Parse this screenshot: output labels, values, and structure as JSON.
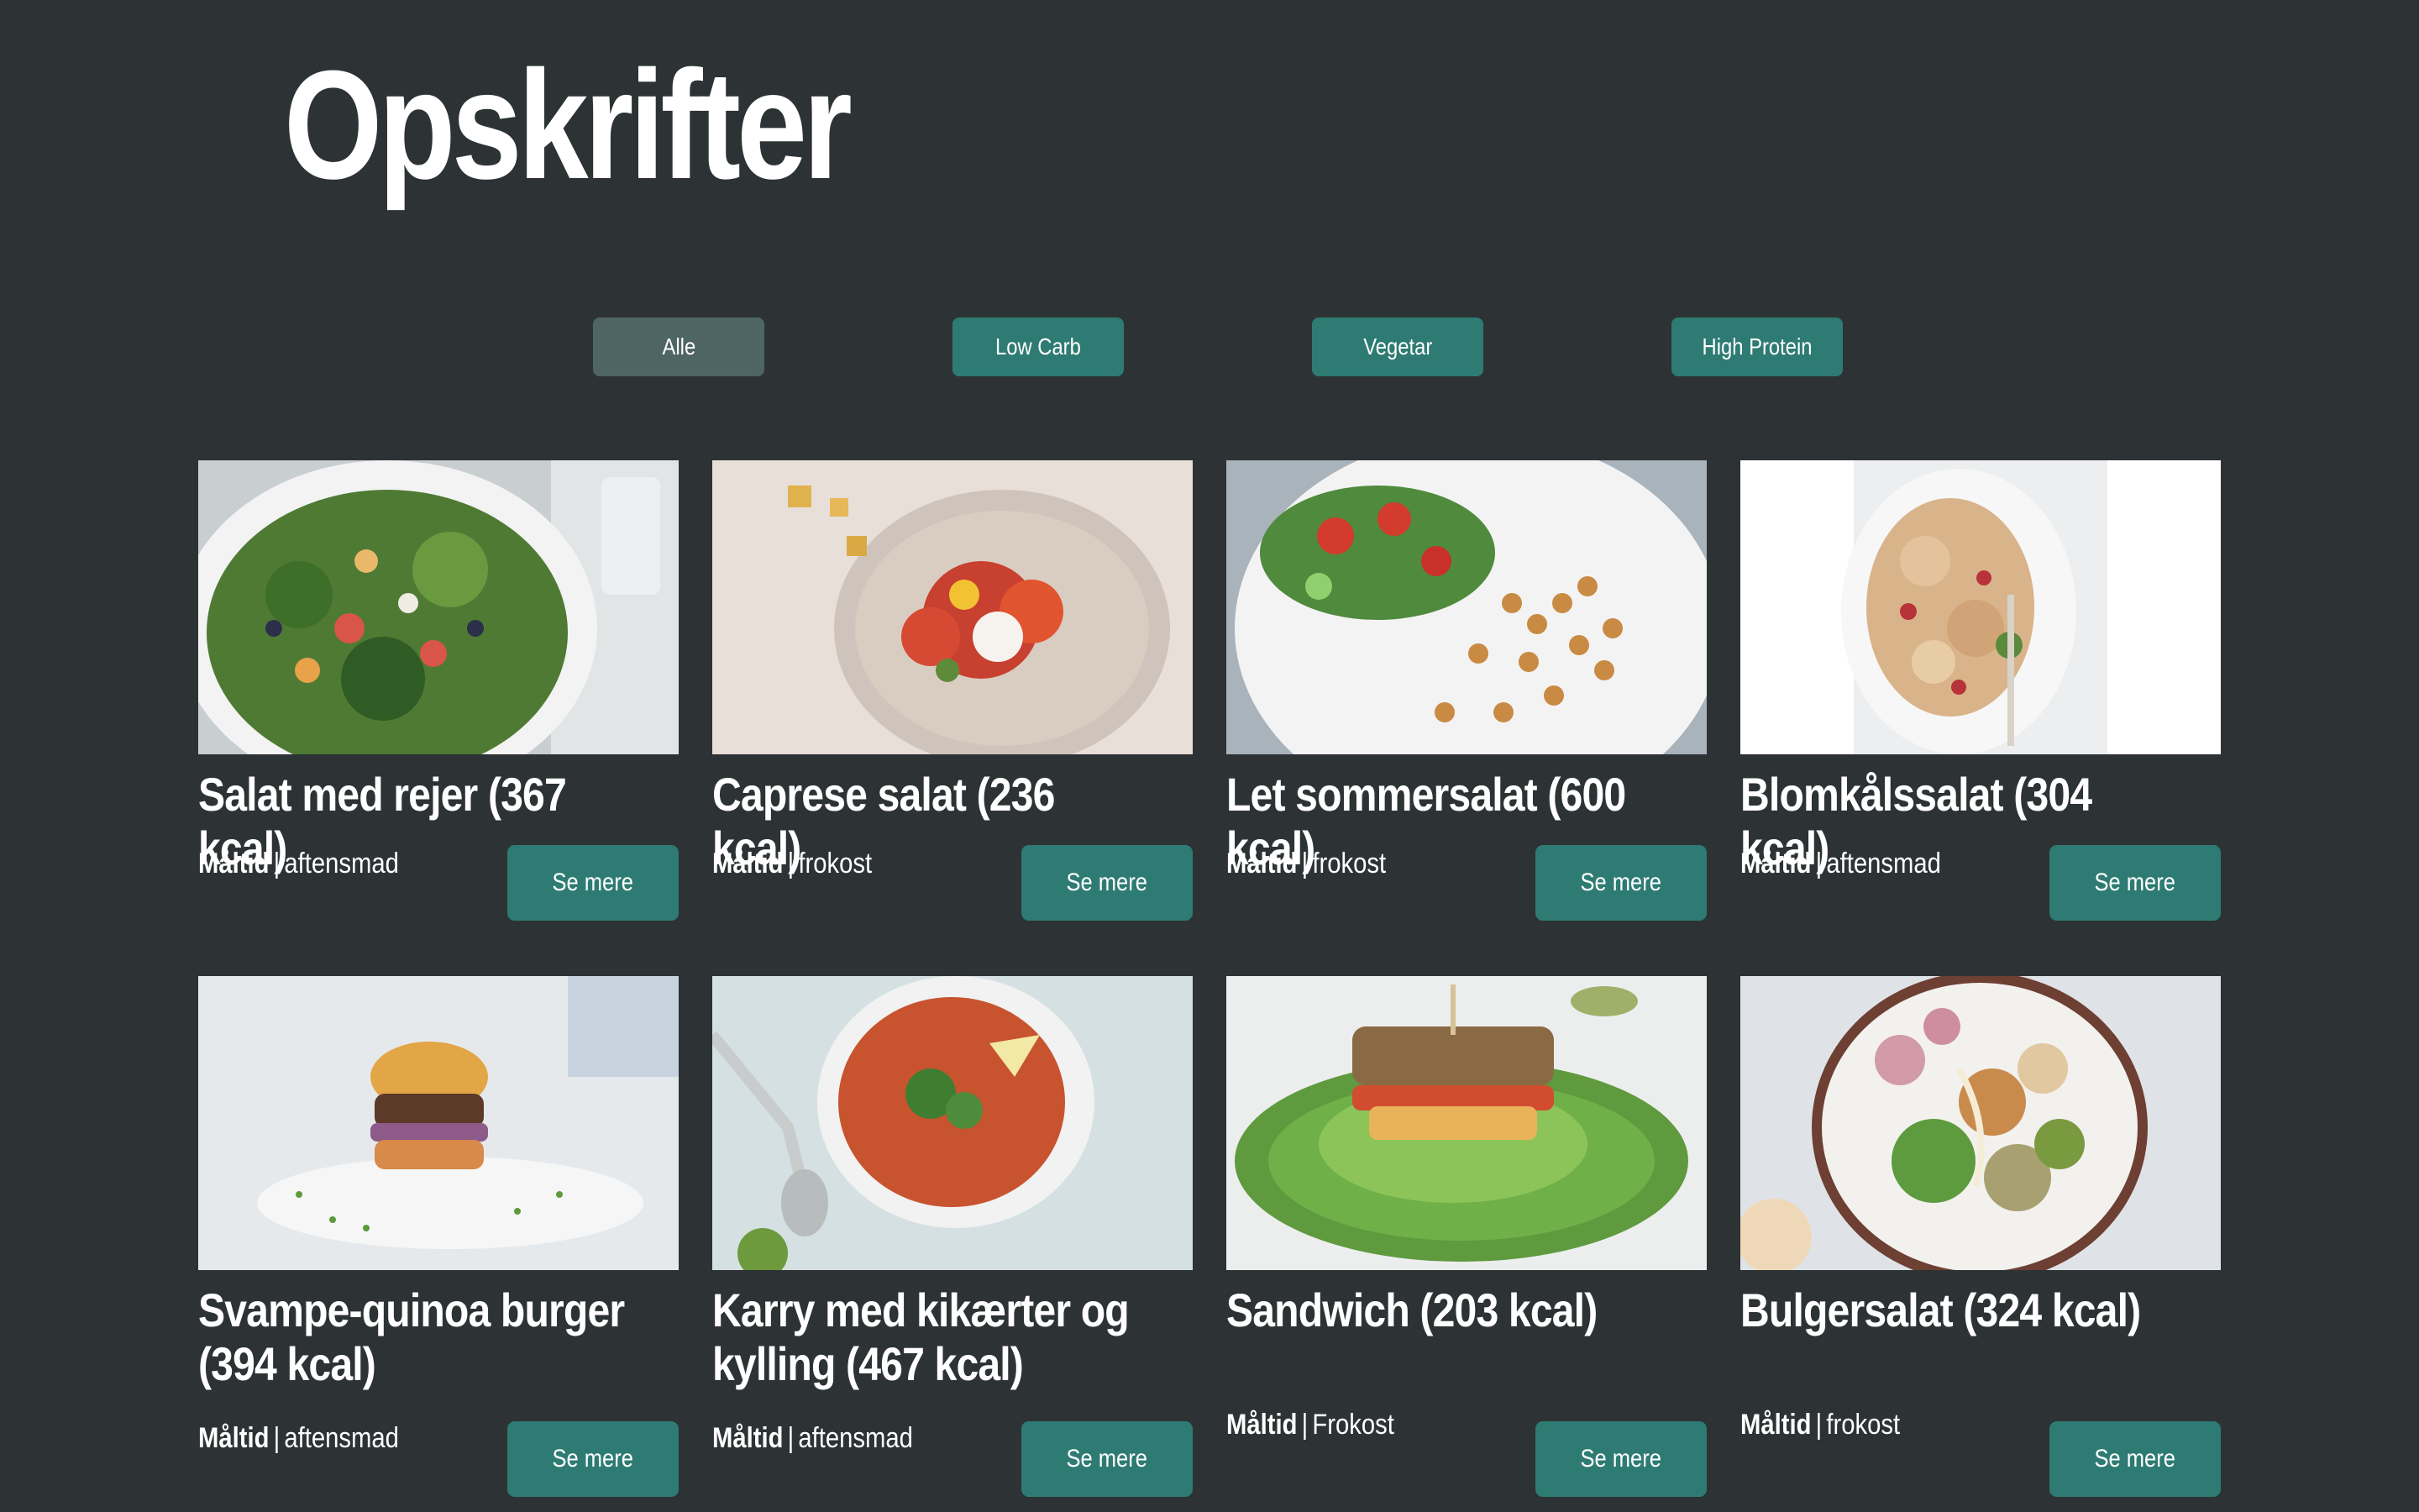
{
  "page": {
    "title": "Opskrifter"
  },
  "filters": [
    {
      "label": "Alle",
      "active": true
    },
    {
      "label": "Low Carb",
      "active": false
    },
    {
      "label": "Vegetar",
      "active": false
    },
    {
      "label": "High Protein",
      "active": false
    }
  ],
  "recipes": [
    {
      "title": "Salat med rejer (367 kcal)",
      "meta_key": "Måltid",
      "meta_value": "aftensmad",
      "button": "Se mere",
      "image": "shrimp-salad-image"
    },
    {
      "title": "Caprese salat (236 kcal)",
      "meta_key": "Måltid",
      "meta_value": "frokost",
      "button": "Se mere",
      "image": "caprese-salad-image"
    },
    {
      "title": "Let sommersalat (600 kcal)",
      "meta_key": "Måltid",
      "meta_value": "frokost",
      "button": "Se mere",
      "image": "summer-salad-image"
    },
    {
      "title": "Blomkålssalat (304 kcal)",
      "meta_key": "Måltid",
      "meta_value": "aftensmad",
      "button": "Se mere",
      "image": "cauliflower-salad-image"
    },
    {
      "title": "Svampe-quinoa burger (394 kcal)",
      "meta_key": "Måltid",
      "meta_value": "aftensmad",
      "button": "Se mere",
      "image": "quinoa-burger-image"
    },
    {
      "title": "Karry med kikærter og kylling (467 kcal)",
      "meta_key": "Måltid",
      "meta_value": "aftensmad",
      "button": "Se mere",
      "image": "chickpea-curry-image"
    },
    {
      "title": "Sandwich (203 kcal)",
      "meta_key": "Måltid",
      "meta_value": "Frokost",
      "button": "Se mere",
      "image": "sandwich-image"
    },
    {
      "title": "Bulgersalat (324 kcal)",
      "meta_key": "Måltid",
      "meta_value": "frokost",
      "button": "Se mere",
      "image": "bulgur-salad-image"
    }
  ],
  "colors": {
    "background": "#2d3334",
    "accent": "#2e7b73",
    "active_filter": "#4e6564",
    "text": "#ffffff"
  }
}
